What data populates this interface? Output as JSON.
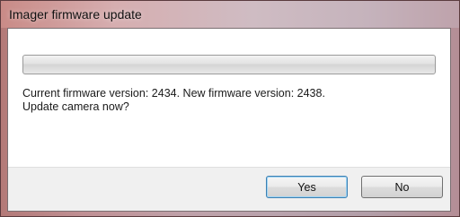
{
  "window": {
    "title": "Imager firmware update"
  },
  "progress": {
    "value": 0
  },
  "message": {
    "line1": "Current firmware version: 2434. New firmware version: 2438.",
    "line2": "Update camera now?"
  },
  "buttons": {
    "yes_label": "Yes",
    "no_label": "No"
  }
}
